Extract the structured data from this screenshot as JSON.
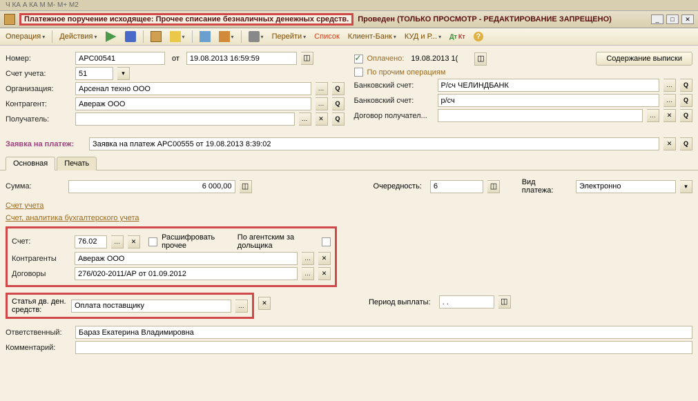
{
  "title": {
    "highlighted": "Платежное поручение исходящее: Прочее списание безналичных денежных средств.",
    "rest": "Проведен (ТОЛЬКО ПРОСМОТР - РЕДАКТИРОВАНИЕ ЗАПРЕЩЕНО)"
  },
  "topmenu": "Ч КА А КА    М М- М+ М2",
  "toolbar": {
    "operation": "Операция",
    "actions": "Действия",
    "goto": "Перейти",
    "list": "Список",
    "clientbank": "Клиент-Банк",
    "kud": "КУД и Р..."
  },
  "header": {
    "number_label": "Номер:",
    "number": "АРС00541",
    "from_label": "от",
    "date": "19.08.2013 16:59:59",
    "paid_label": "Оплачено:",
    "paid_date": "19.08.2013 1(",
    "statement_btn": "Содержание выписки",
    "account_label": "Счет учета:",
    "account": "51",
    "other_ops_label": "По прочим операциям",
    "org_label": "Организация:",
    "org": "Арсенал техно ООО",
    "bank1_label": "Банковский счет:",
    "bank1": "Р/сч ЧЕЛИНДБАНК",
    "counter_label": "Контрагент:",
    "counter": "Авераж ООО",
    "bank2_label": "Банковский счет:",
    "bank2": "р/сч",
    "recipient_label": "Получатель:",
    "recipient": "",
    "contract_recipient_label": "Договор получател...",
    "request_label": "Заявка на платеж:",
    "request": "Заявка на платеж АРС00555 от 19.08.2013 8:39:02"
  },
  "tabs": {
    "main": "Основная",
    "print": "Печать"
  },
  "main_tab": {
    "sum_label": "Сумма:",
    "sum": "6 000,00",
    "order_label": "Очередность:",
    "order": "6",
    "paytype_label": "Вид платежа:",
    "paytype": "Электронно",
    "section_account": "Счет учета",
    "section_analytics": "Счет, аналитика бухгалтерского учета",
    "acc_label": "Счет:",
    "acc": "76.02",
    "decode_label": "Расшифровать прочее",
    "agent_label": "По агентским за дольщика",
    "counter2_label": "Контрагенты",
    "counter2": "Авераж ООО",
    "contracts_label": "Договоры",
    "contracts": "276/020-2011/АР от 01.09.2012",
    "cashflow_label": "Статья дв. ден. средств:",
    "cashflow": "Оплата поставщику",
    "payperiod_label": "Период выплаты:",
    "payperiod": ".   .",
    "responsible_label": "Ответственный:",
    "responsible": "Бараз Екатерина Владимировна",
    "comment_label": "Комментарий:",
    "comment": ""
  }
}
